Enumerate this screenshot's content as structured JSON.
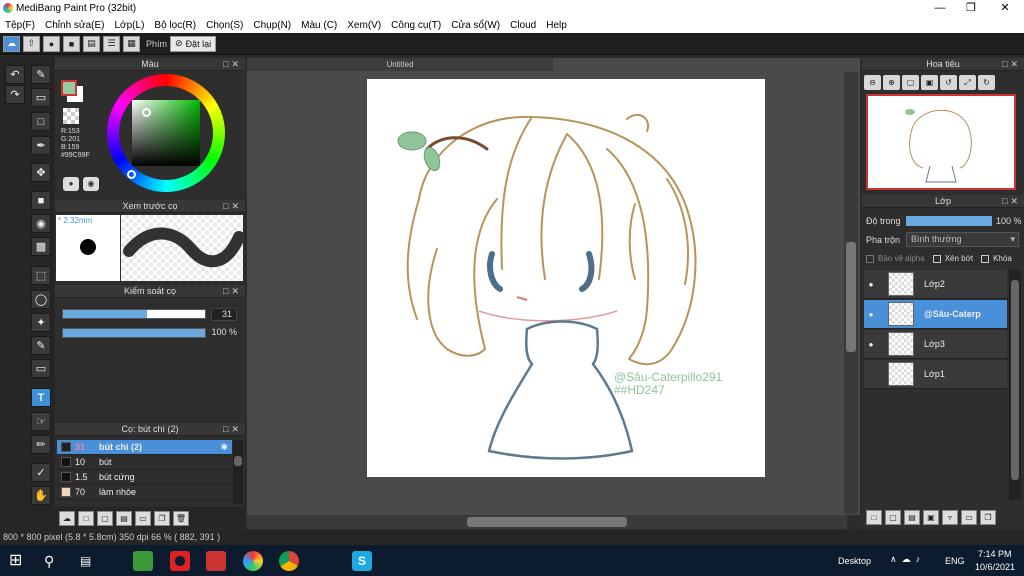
{
  "window": {
    "title": "MediBang Paint Pro (32bit)"
  },
  "menu": [
    "Tệp(F)",
    "Chỉnh sửa(E)",
    "Lớp(L)",
    "Bộ lọc(R)",
    "Chọn(S)",
    "Chụp(N)",
    "Màu (C)",
    "Xem(V)",
    "Công cụ(T)",
    "Cửa sổ(W)",
    "Cloud",
    "Help"
  ],
  "toolbar": {
    "phim_label": "Phím",
    "reset_label": "Đặt lại"
  },
  "color_panel": {
    "title": "Màu",
    "rgb": {
      "r": "R:153",
      "g": "G:201",
      "b": "B:159"
    },
    "hex": "#99C99F",
    "current_color": "#99c99f"
  },
  "brush_preview": {
    "title": "Xem trước cọ",
    "size": "* 2.32mm"
  },
  "brush_control": {
    "title": "Kiểm soát cọ",
    "size_value": "31",
    "size_fraction": 0.59,
    "opacity_value": "100 %",
    "opacity_fraction": 1.0
  },
  "brush_list": {
    "title": "Cọ: bút chì (2)",
    "items": [
      {
        "num": "31",
        "name": "bút chì (2)",
        "swatch": "#222222"
      },
      {
        "num": "10",
        "name": "bút",
        "swatch": "#222222"
      },
      {
        "num": "1.5",
        "name": "bút cứng",
        "swatch": "#222222"
      },
      {
        "num": "70",
        "name": "làm nhòe",
        "swatch": "#f2d5c5"
      }
    ]
  },
  "canvas": {
    "tab_title": "Untitled",
    "watermark_line1": "@Sâu-Caterpillo291",
    "watermark_line2": "##HD247"
  },
  "navigator": {
    "title": "Hoa tiêu"
  },
  "layers_panel": {
    "title": "Lớp",
    "opacity_label": "Độ trong",
    "opacity_value": "100 %",
    "blend_label": "Pha trộn",
    "blend_value": "Bình thường",
    "alpha_label": "Bảo vệ alpha",
    "clip_label": "Xén bớt",
    "lock_label": "Khóa",
    "layers": [
      {
        "name": "Lớp2",
        "selected": false
      },
      {
        "name": "@Sâu-Caterp",
        "selected": true
      },
      {
        "name": "Lớp3",
        "selected": false
      },
      {
        "name": "Lớp1",
        "selected": false
      }
    ]
  },
  "status": {
    "text": "800 * 800 pixel  (5.8 * 5.8cm)  350 dpi  66 %  ( 882, 391 )"
  },
  "taskbar": {
    "desktop_label": "Desktop",
    "lang": "ENG",
    "time": "7:14 PM",
    "date": "10/6/2021"
  }
}
